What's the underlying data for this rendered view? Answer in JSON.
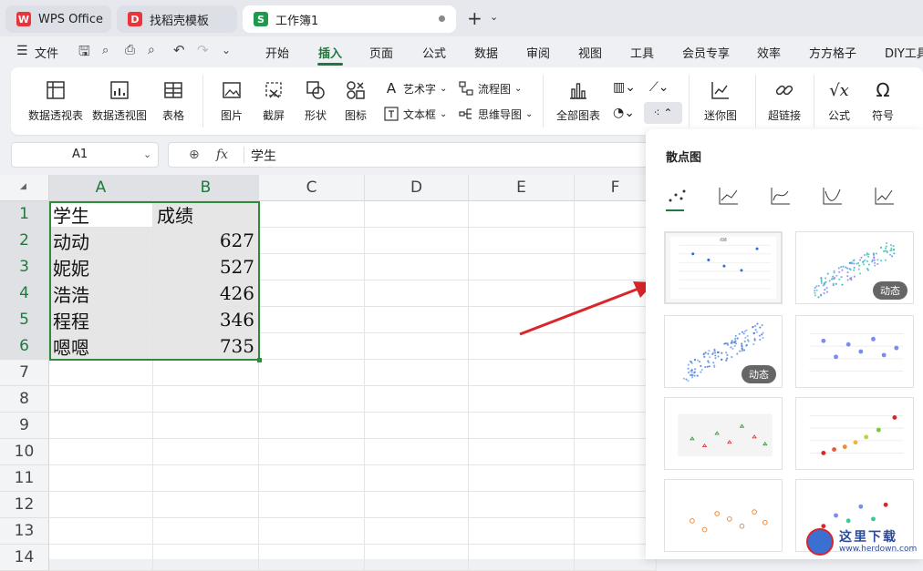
{
  "tabs": [
    {
      "label": "WPS Office",
      "logo": "W"
    },
    {
      "label": "找稻壳模板",
      "logo": "D"
    },
    {
      "label": "工作簿1",
      "logo": "S"
    }
  ],
  "menu": {
    "file": "文件",
    "items": [
      "开始",
      "插入",
      "页面",
      "公式",
      "数据",
      "审阅",
      "视图",
      "工具",
      "会员专享",
      "效率",
      "方方格子",
      "DIY工具"
    ],
    "active": "插入"
  },
  "ribbon": {
    "pivot_table": "数据透视表",
    "pivot_chart": "数据透视图",
    "table": "表格",
    "picture": "图片",
    "screenshot": "截屏",
    "shape": "形状",
    "icon": "图标",
    "wordart": "艺术字",
    "textbox": "文本框",
    "flowchart": "流程图",
    "mindmap": "思维导图",
    "all_charts": "全部图表",
    "sparkline": "迷你图",
    "hyperlink": "超链接",
    "formula": "公式",
    "symbol": "符号"
  },
  "formula_bar": {
    "cell_ref": "A1",
    "fx": "fx",
    "content": "学生"
  },
  "sheet": {
    "columns": [
      "A",
      "B",
      "C",
      "D",
      "E",
      "F"
    ],
    "rows": [
      "1",
      "2",
      "3",
      "4",
      "5",
      "6",
      "7",
      "8",
      "9",
      "10",
      "11",
      "12",
      "13",
      "14"
    ],
    "data": [
      [
        "学生",
        "成绩"
      ],
      [
        "动动",
        "627"
      ],
      [
        "妮妮",
        "527"
      ],
      [
        "浩浩",
        "426"
      ],
      [
        "程程",
        "346"
      ],
      [
        "嗯嗯",
        "735"
      ]
    ]
  },
  "panel": {
    "title": "散点图",
    "badge": "动态"
  },
  "watermark": {
    "text": "这里下载",
    "url": "www.herdown.com"
  },
  "colors": {
    "accent_green": "#1e7a3c",
    "selection_border": "#2e8b3a",
    "arrow_red": "#d9262b"
  }
}
